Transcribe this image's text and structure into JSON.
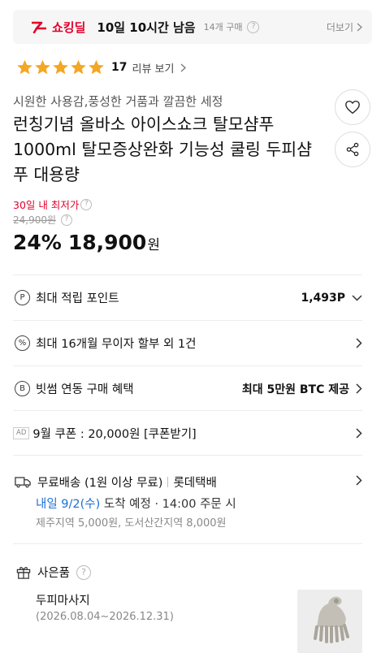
{
  "deal_banner": {
    "name": "쇼킹딜",
    "time_left": "10일 10시간 남음",
    "purchase_count": "14개 구매",
    "more_label": "더보기"
  },
  "rating": {
    "stars": 5,
    "count": "17",
    "label": "리뷰 보기"
  },
  "product": {
    "subtitle": "시원한 사용감,풍성한 거품과 깔끔한 세정",
    "title": "런칭기념 올바소 아이스쇼크 탈모샴푸 1000ml 탈모증상완화 기능성 쿨링 두피샴푸 대용량"
  },
  "price": {
    "lowest_label": "30일 내 최저가",
    "original": "24,900원",
    "discount": "24%",
    "sale": "18,900",
    "unit": "원"
  },
  "benefits": [
    {
      "icon": "P",
      "label": "최대 적립 포인트",
      "value": "1,493P"
    },
    {
      "icon": "%",
      "label": "최대 16개월 무이자 할부 외 1건",
      "value": ""
    },
    {
      "icon": "B",
      "label": "빗썸 연동 구매 혜택",
      "value": "최대 5만원 BTC 제공"
    },
    {
      "icon": "AD",
      "label": "9월 쿠폰 : 20,000원 [쿠폰받기]",
      "value": ""
    }
  ],
  "shipping": {
    "label": "무료배송 (1원 이상 무료)",
    "courier": "롯데택배",
    "date": "내일 9/2(수)",
    "arrival": " 도착 예정 · 14:00 주문 시",
    "note": "제주지역 5,000원, 도서산간지역 8,000원"
  },
  "gift": {
    "title": "사은품",
    "name": "두피마사지",
    "period": "(2026.08.04~2026.12.31)"
  },
  "colors": {
    "accent": "#e4002b",
    "star": "#f5a623",
    "link": "#1c6fd1"
  },
  "icons": [
    "deal-logo-icon",
    "help-icon",
    "chevron-right-icon",
    "star-icon",
    "heart-icon",
    "share-icon",
    "point-icon",
    "percent-icon",
    "bitcoin-icon",
    "ad-icon",
    "chevron-down-icon",
    "truck-icon",
    "gift-icon"
  ]
}
